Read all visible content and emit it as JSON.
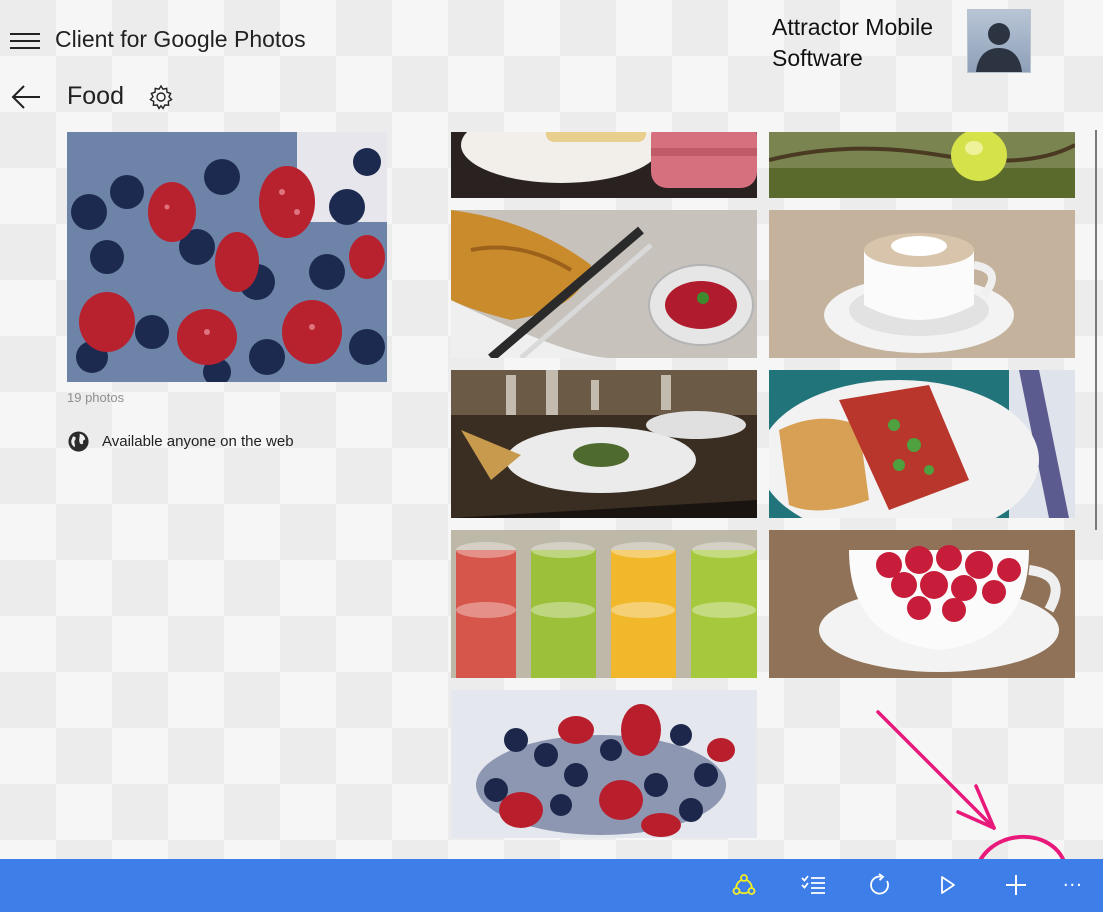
{
  "header": {
    "app_title": "Client for Google Photos",
    "user_name": "Attractor Mobile Software"
  },
  "album": {
    "title": "Food",
    "photo_count": "19 photos",
    "sharing_status": "Available anyone on the web"
  },
  "photos": [
    {
      "subject": "macarons"
    },
    {
      "subject": "green apple on branch"
    },
    {
      "subject": "croissant with jam"
    },
    {
      "subject": "cappuccino cup"
    },
    {
      "subject": "restaurant table setting"
    },
    {
      "subject": "toast with salad"
    },
    {
      "subject": "colorful smoothies"
    },
    {
      "subject": "raspberries in cup"
    },
    {
      "subject": "strawberries and blueberries"
    }
  ],
  "toolbar": {
    "share_icon": "share-icon",
    "select_icon": "select-icon",
    "refresh_icon": "refresh-icon",
    "slideshow_icon": "play-icon",
    "add_icon": "add-icon",
    "more_label": "..."
  },
  "colors": {
    "command_bar": "#3d7ee8",
    "annotation": "#e8197a",
    "share_icon": "#f3f020"
  }
}
